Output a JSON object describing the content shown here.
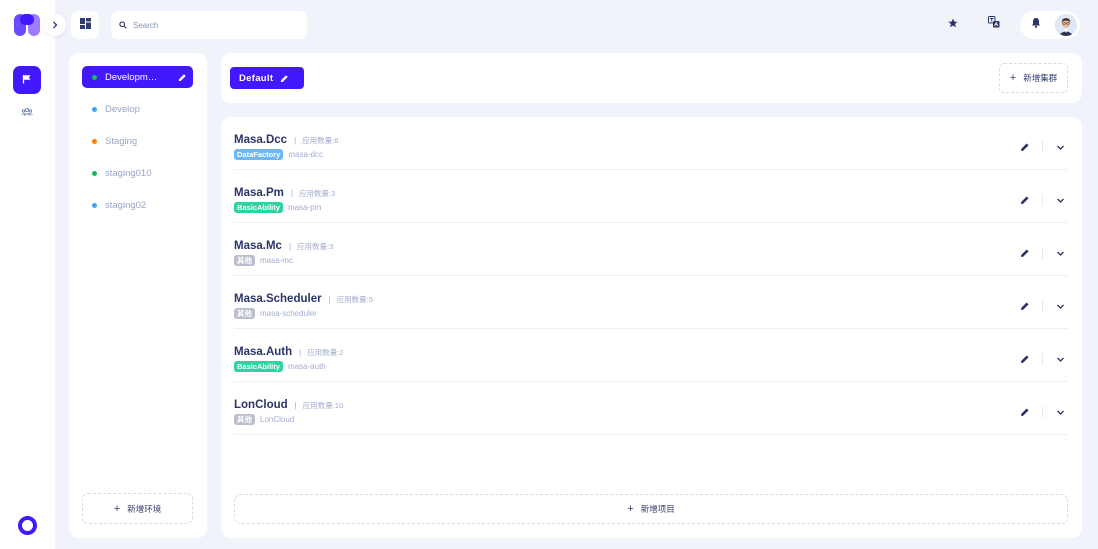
{
  "colors": {
    "accent": "#4318ff",
    "status_green": "#17b85f",
    "status_blue": "#3da5f4",
    "status_orange": "#ff7d00",
    "tag_datafactory": "#6bb8f5",
    "tag_basicability": "#2ed3a3",
    "tag_other": "#b9bdcc"
  },
  "rail": {
    "logo": "masa-logo",
    "items": [
      {
        "icon": "flag-icon",
        "active": true
      },
      {
        "icon": "team-icon",
        "active": false
      }
    ]
  },
  "topbar": {
    "expand_icon": "chevron-right-icon",
    "dashboard_icon": "dashboard-icon",
    "search_placeholder": "Search",
    "star_icon": "star-icon",
    "translate_icon": "translate-icon",
    "bell_icon": "bell-icon"
  },
  "environments": {
    "items": [
      {
        "label": "Development",
        "display": "Developm…",
        "color": "#17b85f",
        "active": true
      },
      {
        "label": "Develop",
        "display": "Develop",
        "color": "#3da5f4",
        "active": false
      },
      {
        "label": "Staging",
        "display": "Staging",
        "color": "#ff7d00",
        "active": false
      },
      {
        "label": "staging010",
        "display": "staging010",
        "color": "#17b85f",
        "active": false
      },
      {
        "label": "staging02",
        "display": "staging02",
        "color": "#3da5f4",
        "active": false
      }
    ],
    "add_label": "新增环境"
  },
  "cluster": {
    "name": "Default",
    "add_label": "新增集群"
  },
  "projects": {
    "items": [
      {
        "name": "Masa.Dcc",
        "count": "应用数量:6",
        "tag": "DataFactory",
        "tag_color": "#6bb8f5",
        "id": "masa-dcc"
      },
      {
        "name": "Masa.Pm",
        "count": "应用数量:3",
        "tag": "BasicAbility",
        "tag_color": "#2ed3a3",
        "id": "masa-pm"
      },
      {
        "name": "Masa.Mc",
        "count": "应用数量:3",
        "tag": "其他",
        "tag_color": "#b9bdcc",
        "id": "masa-mc"
      },
      {
        "name": "Masa.Scheduler",
        "count": "应用数量:5",
        "tag": "其他",
        "tag_color": "#b9bdcc",
        "id": "masa-scheduler"
      },
      {
        "name": "Masa.Auth",
        "count": "应用数量:2",
        "tag": "BasicAbility",
        "tag_color": "#2ed3a3",
        "id": "masa-auth"
      },
      {
        "name": "LonCloud",
        "count": "应用数量:10",
        "tag": "其他",
        "tag_color": "#b9bdcc",
        "id": "LonCloud"
      }
    ],
    "separator": "|",
    "add_label": "新增项目"
  }
}
